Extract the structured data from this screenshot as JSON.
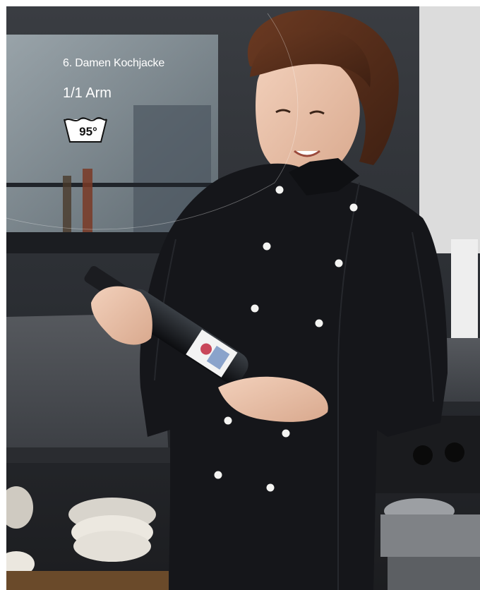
{
  "caption": {
    "title": "6. Damen Kochjacke",
    "sleeve": "1/1 Arm",
    "wash_temperature": "95°"
  },
  "icons": {
    "wash": "wash-tub-icon"
  },
  "colors": {
    "jacket": "#15161a",
    "buttons": "#f4f4f2",
    "countertop": "#4a4d52",
    "caption_text": "#ffffff"
  }
}
